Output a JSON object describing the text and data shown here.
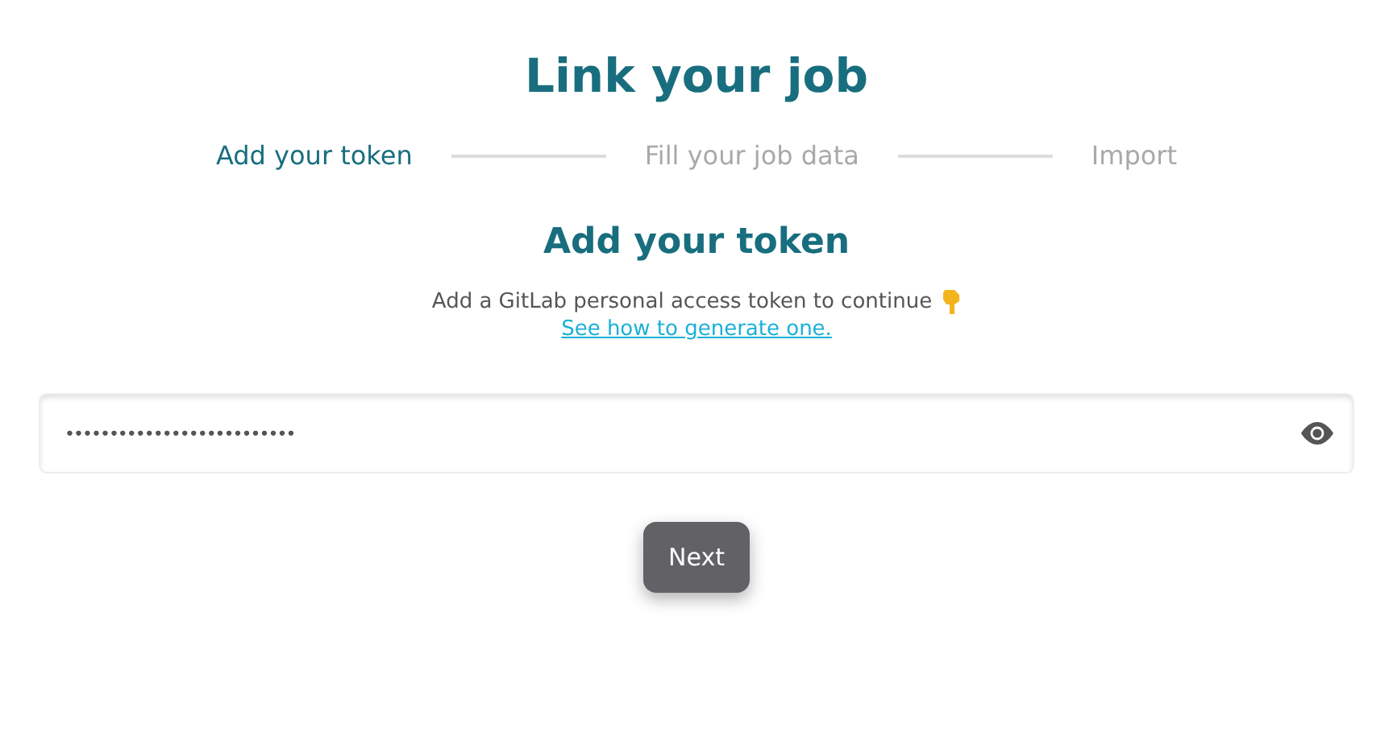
{
  "title": "Link your job",
  "steps": [
    {
      "label": "Add your token",
      "selected": true
    },
    {
      "label": "Fill your job data",
      "selected": false
    },
    {
      "label": "Import",
      "selected": false
    }
  ],
  "section": {
    "heading": "Add your token",
    "description": "Add a GitLab personal access token to continue",
    "link": "See how to generate one."
  },
  "token_field": {
    "value": "••••••••••••••••••••••••••"
  },
  "buttons": [
    {
      "label": "Next"
    }
  ]
}
